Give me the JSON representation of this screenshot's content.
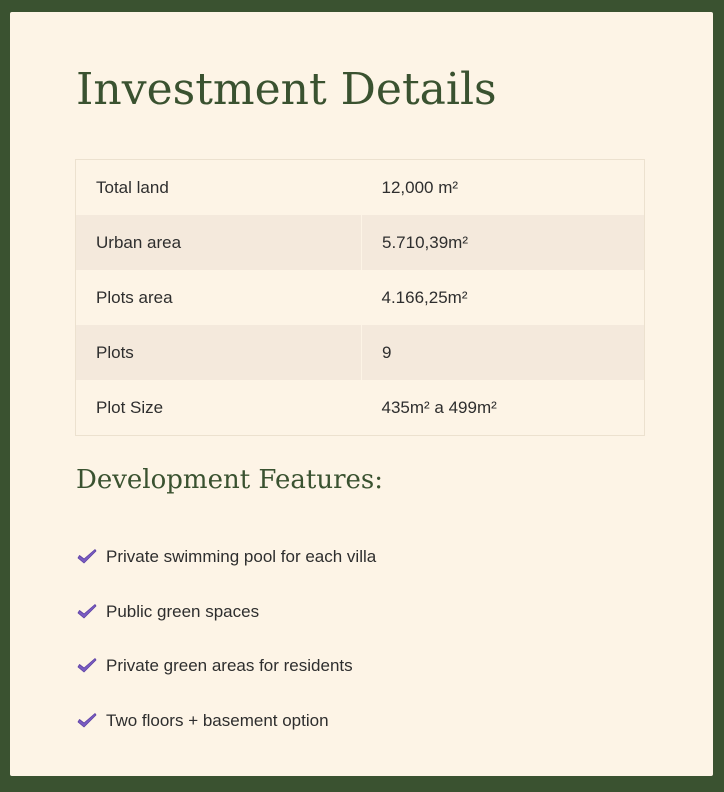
{
  "page": {
    "title": "Investment Details",
    "table": {
      "rows": [
        {
          "label": "Total land",
          "value": "12,000 m²"
        },
        {
          "label": "Urban area",
          "value": "5.710,39m²"
        },
        {
          "label": "Plots area",
          "value": "4.166,25m²"
        },
        {
          "label": "Plots",
          "value": "9"
        },
        {
          "label": "Plot Size",
          "value": "435m² a 499m²"
        }
      ]
    },
    "features": {
      "title": "Development Features:",
      "items": [
        {
          "text": "Private swimming pool for each villa",
          "icon": "check-icon"
        },
        {
          "text": "Public green spaces",
          "icon": "check-icon"
        },
        {
          "text": "Private green areas for residents",
          "icon": "check-icon"
        },
        {
          "text": "Two floors + basement option",
          "icon": "check-icon"
        }
      ]
    }
  },
  "colors": {
    "background": "#3a5230",
    "card": "#fdf4e6",
    "heading": "#3a5230",
    "table_alt_row": "#f4e9dc",
    "check": "#7a5cc2"
  }
}
